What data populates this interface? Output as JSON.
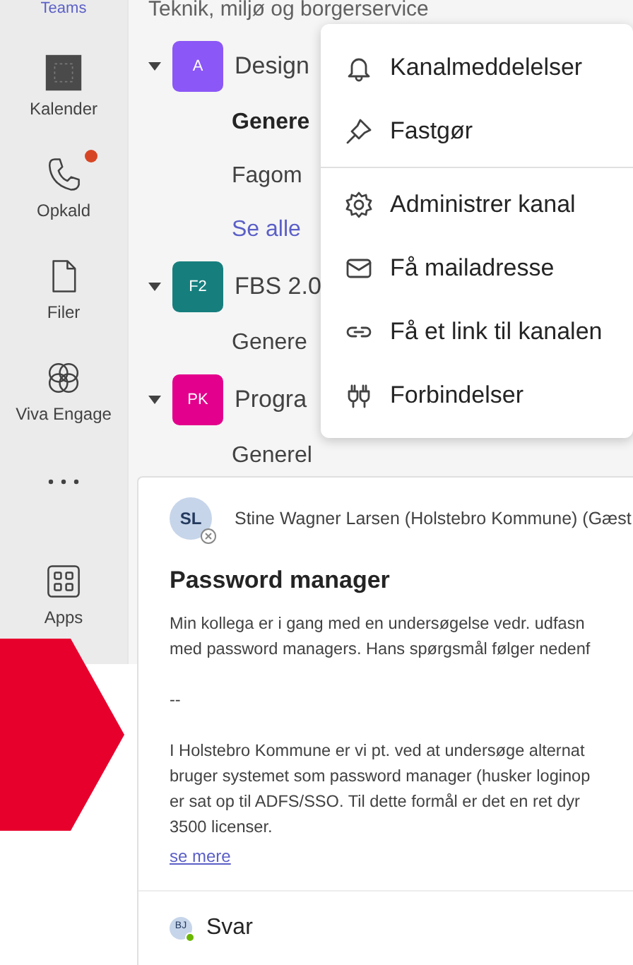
{
  "rail": {
    "top_label": "Teams",
    "items": [
      {
        "label": "Kalender",
        "kind": "calendar",
        "badge": false
      },
      {
        "label": "Opkald",
        "kind": "phone",
        "badge": true
      },
      {
        "label": "Filer",
        "kind": "file",
        "badge": false
      },
      {
        "label": "Viva Engage",
        "kind": "engage",
        "badge": false
      },
      {
        "kind": "more",
        "badge": false
      },
      {
        "label": "Apps",
        "kind": "apps",
        "badge": false
      }
    ]
  },
  "channel_list": {
    "top_text": "Teknik, miljø og borgerservice",
    "teams": [
      {
        "initials": "A",
        "name": "Design",
        "color": "#8b57f6",
        "channels": [
          {
            "name": "Genere",
            "kind": "bold"
          },
          {
            "name": "Fagom",
            "kind": "plain"
          },
          {
            "name": "Se alle",
            "kind": "link"
          }
        ]
      },
      {
        "initials": "F2",
        "name": "FBS 2.0",
        "color": "#167f7e",
        "channels": [
          {
            "name": "Genere",
            "kind": "plain"
          }
        ]
      },
      {
        "initials": "PK",
        "name": "Progra",
        "color": "#e3008c",
        "channels": [
          {
            "name": "Generel",
            "kind": "plain"
          }
        ]
      }
    ]
  },
  "context_menu": {
    "sections": [
      [
        {
          "label": "Kanalmeddelelser",
          "kind": "bell"
        },
        {
          "label": "Fastgør",
          "kind": "pin"
        }
      ],
      [
        {
          "label": "Administrer kanal",
          "kind": "gear"
        },
        {
          "label": "Få mailadresse",
          "kind": "mail"
        },
        {
          "label": "Få et link til kanalen",
          "kind": "link"
        },
        {
          "label": "Forbindelser",
          "kind": "plug"
        }
      ]
    ]
  },
  "post": {
    "author_initials": "SL",
    "author": "Stine Wagner Larsen (Holstebro Kommune) (Gæst",
    "title": "Password manager",
    "paragraphs": [
      [
        "Min kollega er i gang med en undersøgelse vedr. udfasn",
        "med password managers. Hans spørgsmål følger nedenf"
      ],
      [
        "--"
      ],
      [
        "I Holstebro Kommune er vi pt. ved at undersøge alternat",
        "bruger systemet som password manager (husker loginop",
        "er sat op til ADFS/SSO. Til dette formål er det en ret dyr",
        "3500 licenser."
      ]
    ],
    "more_link": "se mere",
    "reply_initials": "BJ",
    "reply_label": "Svar"
  }
}
